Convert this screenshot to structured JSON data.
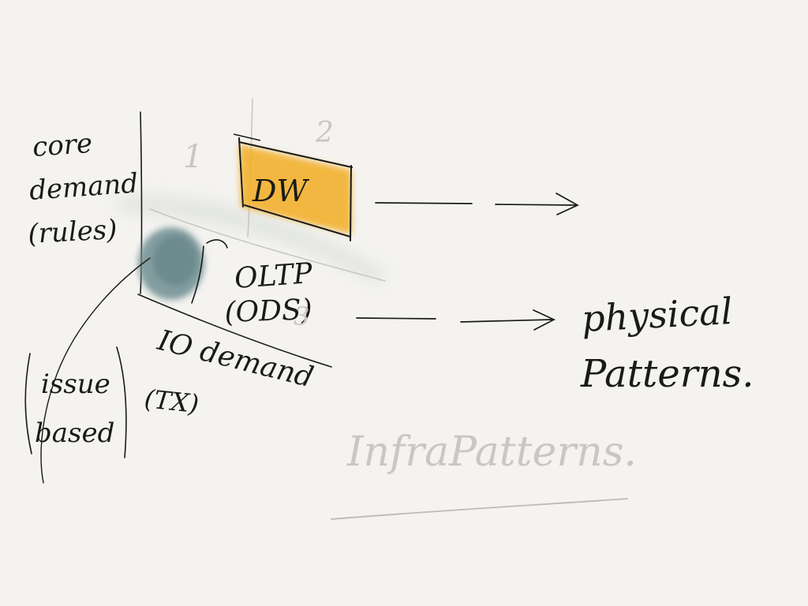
{
  "labels": {
    "core_demand": [
      "core",
      "demand",
      "(rules)"
    ],
    "issue_based": [
      "issue",
      "based"
    ],
    "io_demand": [
      "IO demand",
      "(TX)"
    ],
    "dw": "DW",
    "oltp": [
      "OLTP",
      "(ODS)"
    ],
    "physical_patterns": [
      "physical",
      "Patterns."
    ],
    "infra_patterns": "InfraPatterns."
  },
  "quadrant_numbers": [
    "1",
    "2",
    "3"
  ],
  "colors": {
    "dw_fill": "#f2b233",
    "oltp_fill": "#6f8f93",
    "ink": "#1a1a1a",
    "faint": "#c9c7c2"
  }
}
